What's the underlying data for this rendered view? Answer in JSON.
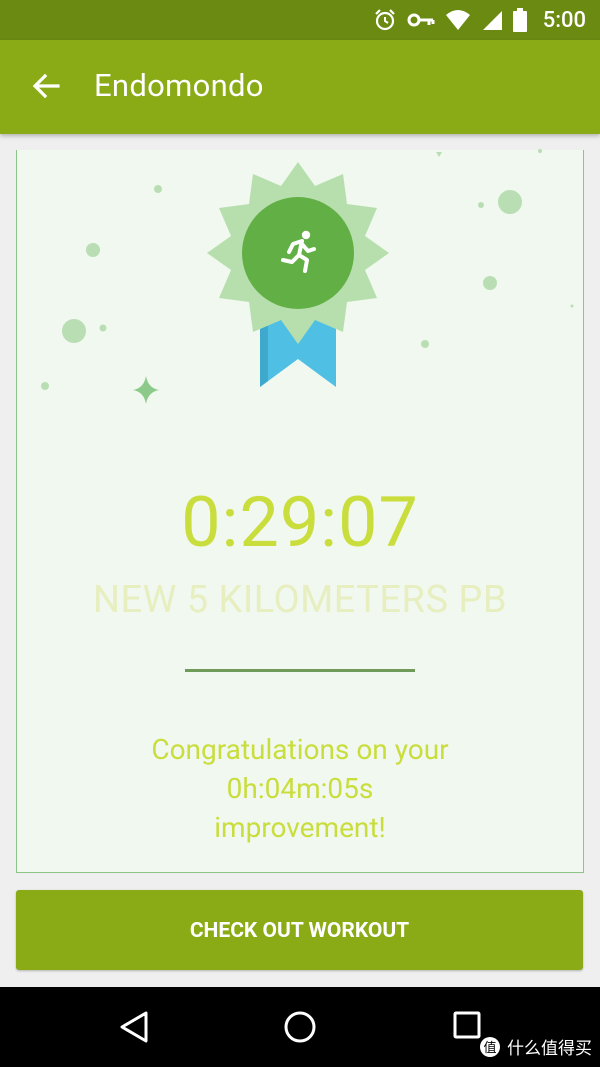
{
  "status_bar": {
    "time": "5:00",
    "icons": [
      "alarm-icon",
      "vpn-key-icon",
      "wifi-icon",
      "cellular-signal-icon",
      "battery-icon"
    ]
  },
  "app_bar": {
    "title": "Endomondo",
    "back_icon": "arrow-back-icon",
    "color": "#8aab16"
  },
  "achievement": {
    "badge_icon": "running-person-icon",
    "time": "0:29:07",
    "title": "NEW 5 KILOMETERS PB",
    "message_line1": "Congratulations on your",
    "message_line2": "0h:04m:05s",
    "message_line3": "improvement!",
    "accent_color": "#c9dd3d"
  },
  "cta": {
    "label": "CHECK OUT WORKOUT"
  },
  "nav_bar": {
    "icons": [
      "back-triangle-icon",
      "home-circle-icon",
      "recents-square-icon"
    ]
  },
  "watermark": {
    "text": "什么值得买",
    "badge": "值"
  }
}
